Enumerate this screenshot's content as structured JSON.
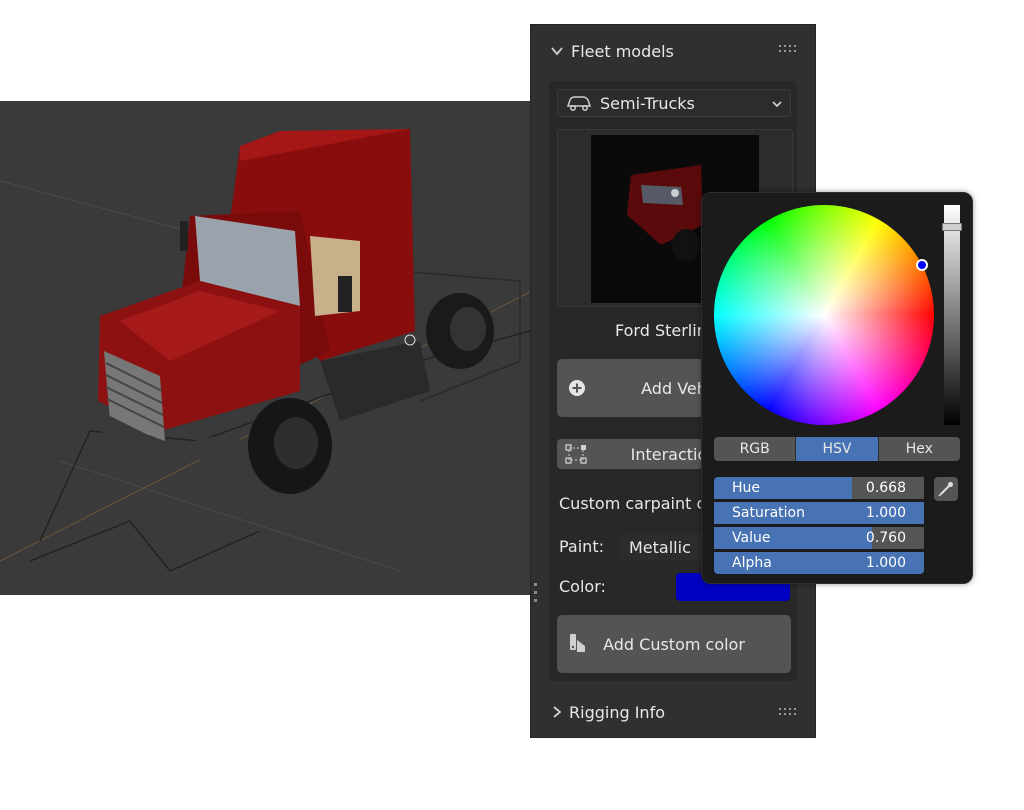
{
  "panel": {
    "header_title": "Fleet models",
    "category_dropdown": "Semi-Trucks",
    "model_name": "Ford Sterling A",
    "add_vehicle_label": "Add Veh",
    "interaction_label": "Interaction",
    "custom_section_title": "Custom carpaint co",
    "paint_label": "Paint:",
    "paint_value": "Metallic",
    "color_label": "Color:",
    "color_value": "#0000c2",
    "add_custom_color_label": "Add Custom color",
    "rigging_label": "Rigging Info"
  },
  "picker": {
    "tabs": [
      "RGB",
      "HSV",
      "Hex"
    ],
    "active_tab": "HSV",
    "fields": {
      "hue": {
        "label": "Hue",
        "value": "0.668"
      },
      "saturation": {
        "label": "Saturation",
        "value": "1.000"
      },
      "value": {
        "label": "Value",
        "value": "0.760"
      },
      "alpha": {
        "label": "Alpha",
        "value": "1.000"
      }
    },
    "current_color": "#0000c2"
  },
  "icons": {
    "panel_chevron": "chevron-down-icon",
    "grip": "drag-grip-icon",
    "car": "car-icon",
    "dropdown_arrow": "chevron-down-icon",
    "add_vehicle": "add-circle-icon",
    "interaction": "bounding-box-icon",
    "paint": "paint-brush-icon",
    "rigging_chevron": "chevron-right-icon",
    "eyedropper": "eyedropper-icon"
  }
}
